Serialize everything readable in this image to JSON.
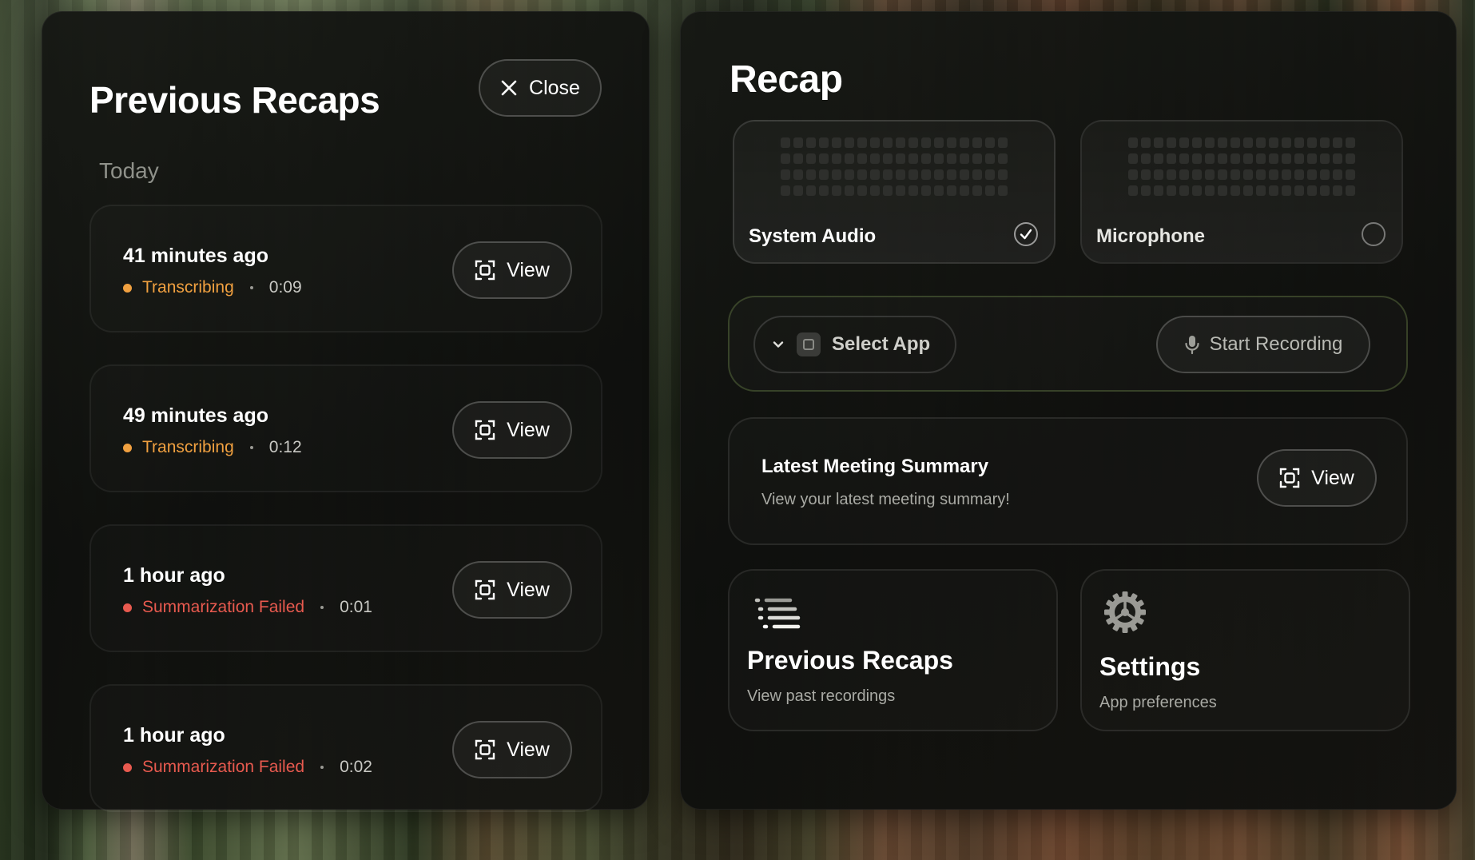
{
  "left_panel": {
    "title": "Previous Recaps",
    "close_label": "Close",
    "section": "Today",
    "recaps": [
      {
        "time": "41 minutes ago",
        "status": "Transcribing",
        "status_color": "#f0a040",
        "duration": "0:09",
        "view_label": "View"
      },
      {
        "time": "49 minutes ago",
        "status": "Transcribing",
        "status_color": "#f0a040",
        "duration": "0:12",
        "view_label": "View"
      },
      {
        "time": "1 hour ago",
        "status": "Summarization Failed",
        "status_color": "#e85a4f",
        "duration": "0:01",
        "view_label": "View"
      },
      {
        "time": "1 hour ago",
        "status": "Summarization Failed",
        "status_color": "#e85a4f",
        "duration": "0:02",
        "view_label": "View"
      }
    ]
  },
  "right_panel": {
    "title": "Recap",
    "sources": [
      {
        "label": "System Audio",
        "selected": true
      },
      {
        "label": "Microphone",
        "selected": false
      }
    ],
    "select_app_label": "Select App",
    "start_recording_label": "Start Recording",
    "latest_summary": {
      "title": "Latest Meeting Summary",
      "subtitle": "View your latest meeting summary!",
      "view_label": "View"
    },
    "nav": {
      "previous_recaps": {
        "title": "Previous Recaps",
        "subtitle": "View past recordings",
        "icon": "list-icon"
      },
      "settings": {
        "title": "Settings",
        "subtitle": "App preferences",
        "icon": "gear-icon"
      }
    }
  }
}
